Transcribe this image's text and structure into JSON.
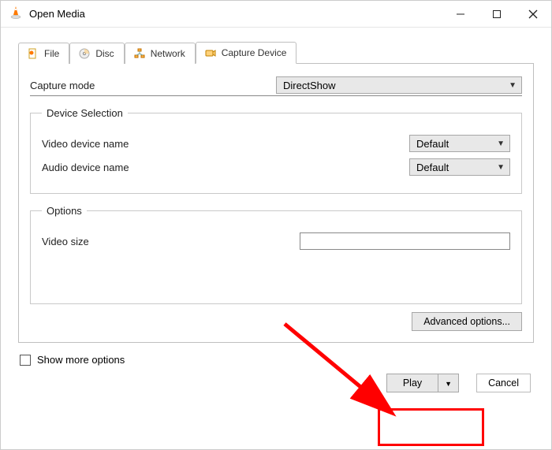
{
  "window": {
    "title": "Open Media"
  },
  "tabs": {
    "file": "File",
    "disc": "Disc",
    "network": "Network",
    "capture": "Capture Device"
  },
  "capture": {
    "mode_label": "Capture mode",
    "mode_value": "DirectShow",
    "device_selection_legend": "Device Selection",
    "video_device_label": "Video device name",
    "video_device_value": "Default",
    "audio_device_label": "Audio device name",
    "audio_device_value": "Default",
    "options_legend": "Options",
    "video_size_label": "Video size",
    "video_size_value": "",
    "advanced_button": "Advanced options..."
  },
  "footer": {
    "show_more_label": "Show more options",
    "play_label": "Play",
    "cancel_label": "Cancel"
  }
}
